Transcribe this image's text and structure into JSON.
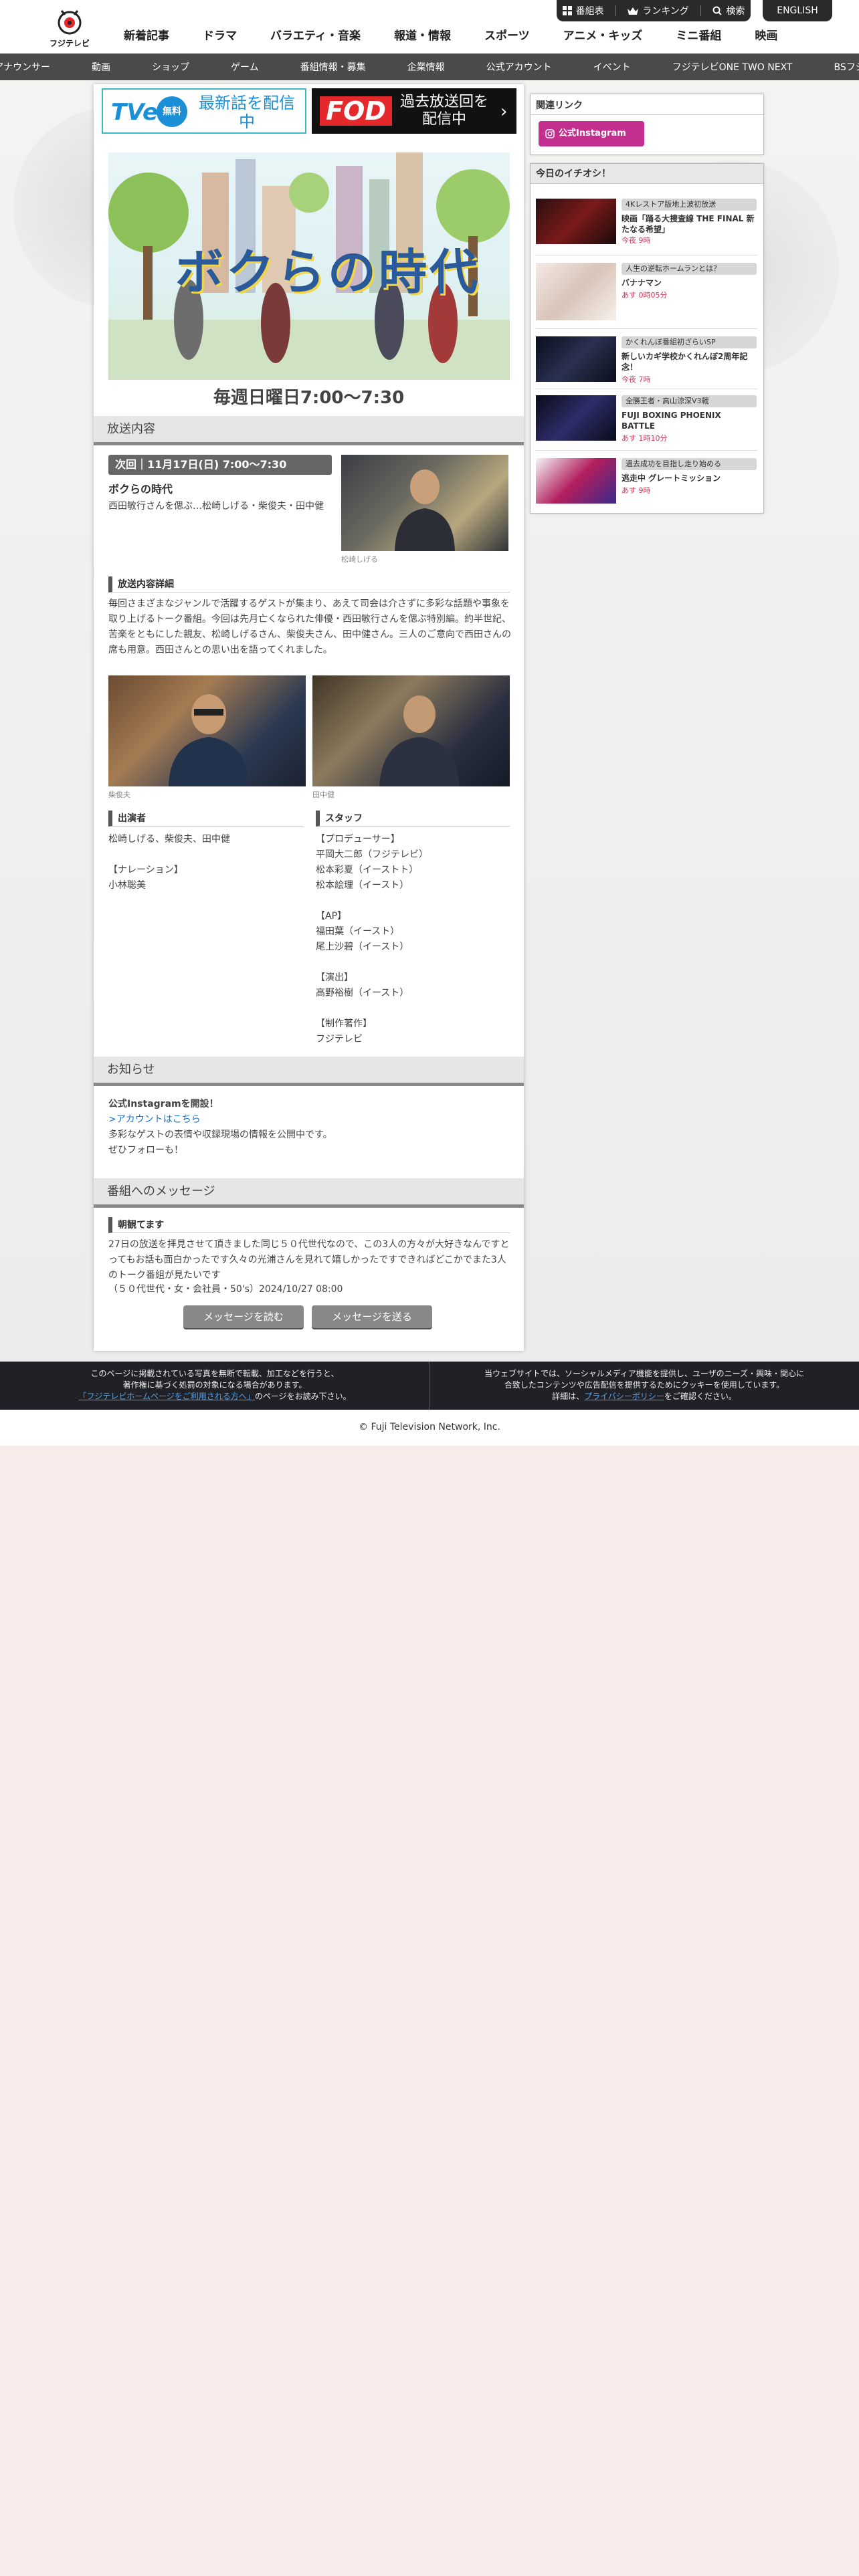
{
  "header": {
    "logo_text": "フジテレビ",
    "nav": [
      "新着記事",
      "ドラマ",
      "バラエティ・音楽",
      "報道・情報",
      "スポーツ",
      "アニメ・キッズ",
      "ミニ番組",
      "映画"
    ],
    "util": {
      "schedule": "番組表",
      "ranking": "ランキング",
      "search": "検索"
    },
    "english": "ENGLISH"
  },
  "subnav": [
    "アナウンサー",
    "動画",
    "ショップ",
    "ゲーム",
    "番組情報・募集",
    "企業情報",
    "公式アカウント",
    "イベント",
    "フジテレビONE TWO NEXT",
    "BSフジ"
  ],
  "banners": {
    "tver_logo": "TVer",
    "tver_free": "無料",
    "tver_text": "最新話を配信中",
    "fod_logo": "FOD",
    "fod_text": "過去放送回を配信中",
    "fod_arrow": "›"
  },
  "show": {
    "title": "ボクらの時代",
    "airtime": "毎週日曜日7:00〜7:30"
  },
  "broadcast": {
    "section_title": "放送内容",
    "next_label": "次回｜11月17日(日) 7:00〜7:30",
    "episode_title": "ボクらの時代",
    "episode_summary": "西田敏行さんを偲ぶ…松崎しげる・柴俊夫・田中健",
    "photo_caption": "松崎しげる",
    "detail_heading": "放送内容詳細",
    "detail_text": "毎回さまざまなジャンルで活躍するゲストが集まり、あえて司会は介さずに多彩な話題や事象を取り上げるトーク番組。今回は先月亡くなられた俳優・西田敏行さんを偲ぶ特別編。約半世紀、苦楽をともにした親友、松崎しげるさん、柴俊夫さん、田中健さん。三人のご意向で西田さんの席も用意。西田さんとの思い出を語ってくれました。",
    "photo_left_caption": "柴俊夫",
    "photo_right_caption": "田中健",
    "cast_heading": "出演者",
    "cast_lines": [
      "松崎しげる、柴俊夫、田中健",
      "",
      "【ナレーション】",
      "小林聡美"
    ],
    "staff_heading": "スタッフ",
    "staff_lines": [
      "【プロデューサー】",
      "平岡大二郎（フジテレビ）",
      "松本彩夏（イーストト）",
      "松本絵理（イースト）",
      "",
      "【AP】",
      "福田葉（イースト）",
      "尾上沙碧（イースト）",
      "",
      "【演出】",
      "高野裕樹（イースト）",
      "",
      "【制作著作】",
      "フジテレビ"
    ]
  },
  "notice": {
    "section_title": "お知らせ",
    "title": "公式Instagramを開設！",
    "link": ">アカウントはこちら",
    "lines": [
      "多彩なゲストの表情や収録現場の情報を公開中です。",
      "ぜひフォローも！"
    ]
  },
  "message": {
    "section_title": "番組へのメッセージ",
    "heading": "朝観てます",
    "body": "27日の放送を拝見させて頂きました同じ５０代世代なので、この3人の方々が大好きなんですとってもお話も面白かったです久々の光浦さんを見れて嬉しかったですできればどこかでまた3人のトーク番組が見たいです",
    "meta": "（５０代世代・女・会社員・50's）2024/10/27 08:00",
    "read_button": "メッセージを読む",
    "send_button": "メッセージを送る"
  },
  "sidebar": {
    "related_title": "関連リンク",
    "instagram_button": "公式Instagram",
    "pickup_title": "今日のイチオシ！",
    "pickup_items": [
      {
        "badge": "4Kレストア版地上波初放送",
        "name": "映画「踊る大捜査線 THE FINAL 新たなる希望」",
        "time": "今夜 9時"
      },
      {
        "badge": "人生の逆転ホームランとは？",
        "name": "バナナマン",
        "time": "あす 0時05分"
      },
      {
        "badge": "かくれんぼ番組初ざらいSP",
        "name": "新しいカギ学校かくれんぼ2周年記念！",
        "time": "今夜 7時"
      },
      {
        "badge": "全勝王者・高山涼深V3戦",
        "name": "FUJI BOXING PHOENIX BATTLE",
        "time": "あす 1時10分"
      },
      {
        "badge": "過去成功を目指し走り始める",
        "name": "逃走中 グレートミッション",
        "time": "あす 9時"
      }
    ]
  },
  "footer": {
    "left_lines": [
      "このページに掲載されている写真を無断で転載、加工などを行うと、",
      "著作権に基づく処罰の対象になる場合があります。"
    ],
    "left_link": "「フジテレビホームページをご利用される方へ」",
    "left_tail": "のページをお読み下さい。",
    "right_lines": [
      "当ウェブサイトでは、ソーシャルメディア機能を提供し、ユーザのニーズ・興味・関心に",
      "合致したコンテンツや広告配信を提供するためにクッキーを使用しています。"
    ],
    "right_pre": "詳細は、",
    "right_link": "プライバシーポリシー",
    "right_tail": "をご確認ください。",
    "copyright": "© Fuji Television Network, Inc."
  },
  "colors": {
    "instagram": "#c22f8e",
    "fod_red": "#e4282b",
    "tver_blue": "#1a8fd8",
    "time_red": "#d0395a"
  }
}
